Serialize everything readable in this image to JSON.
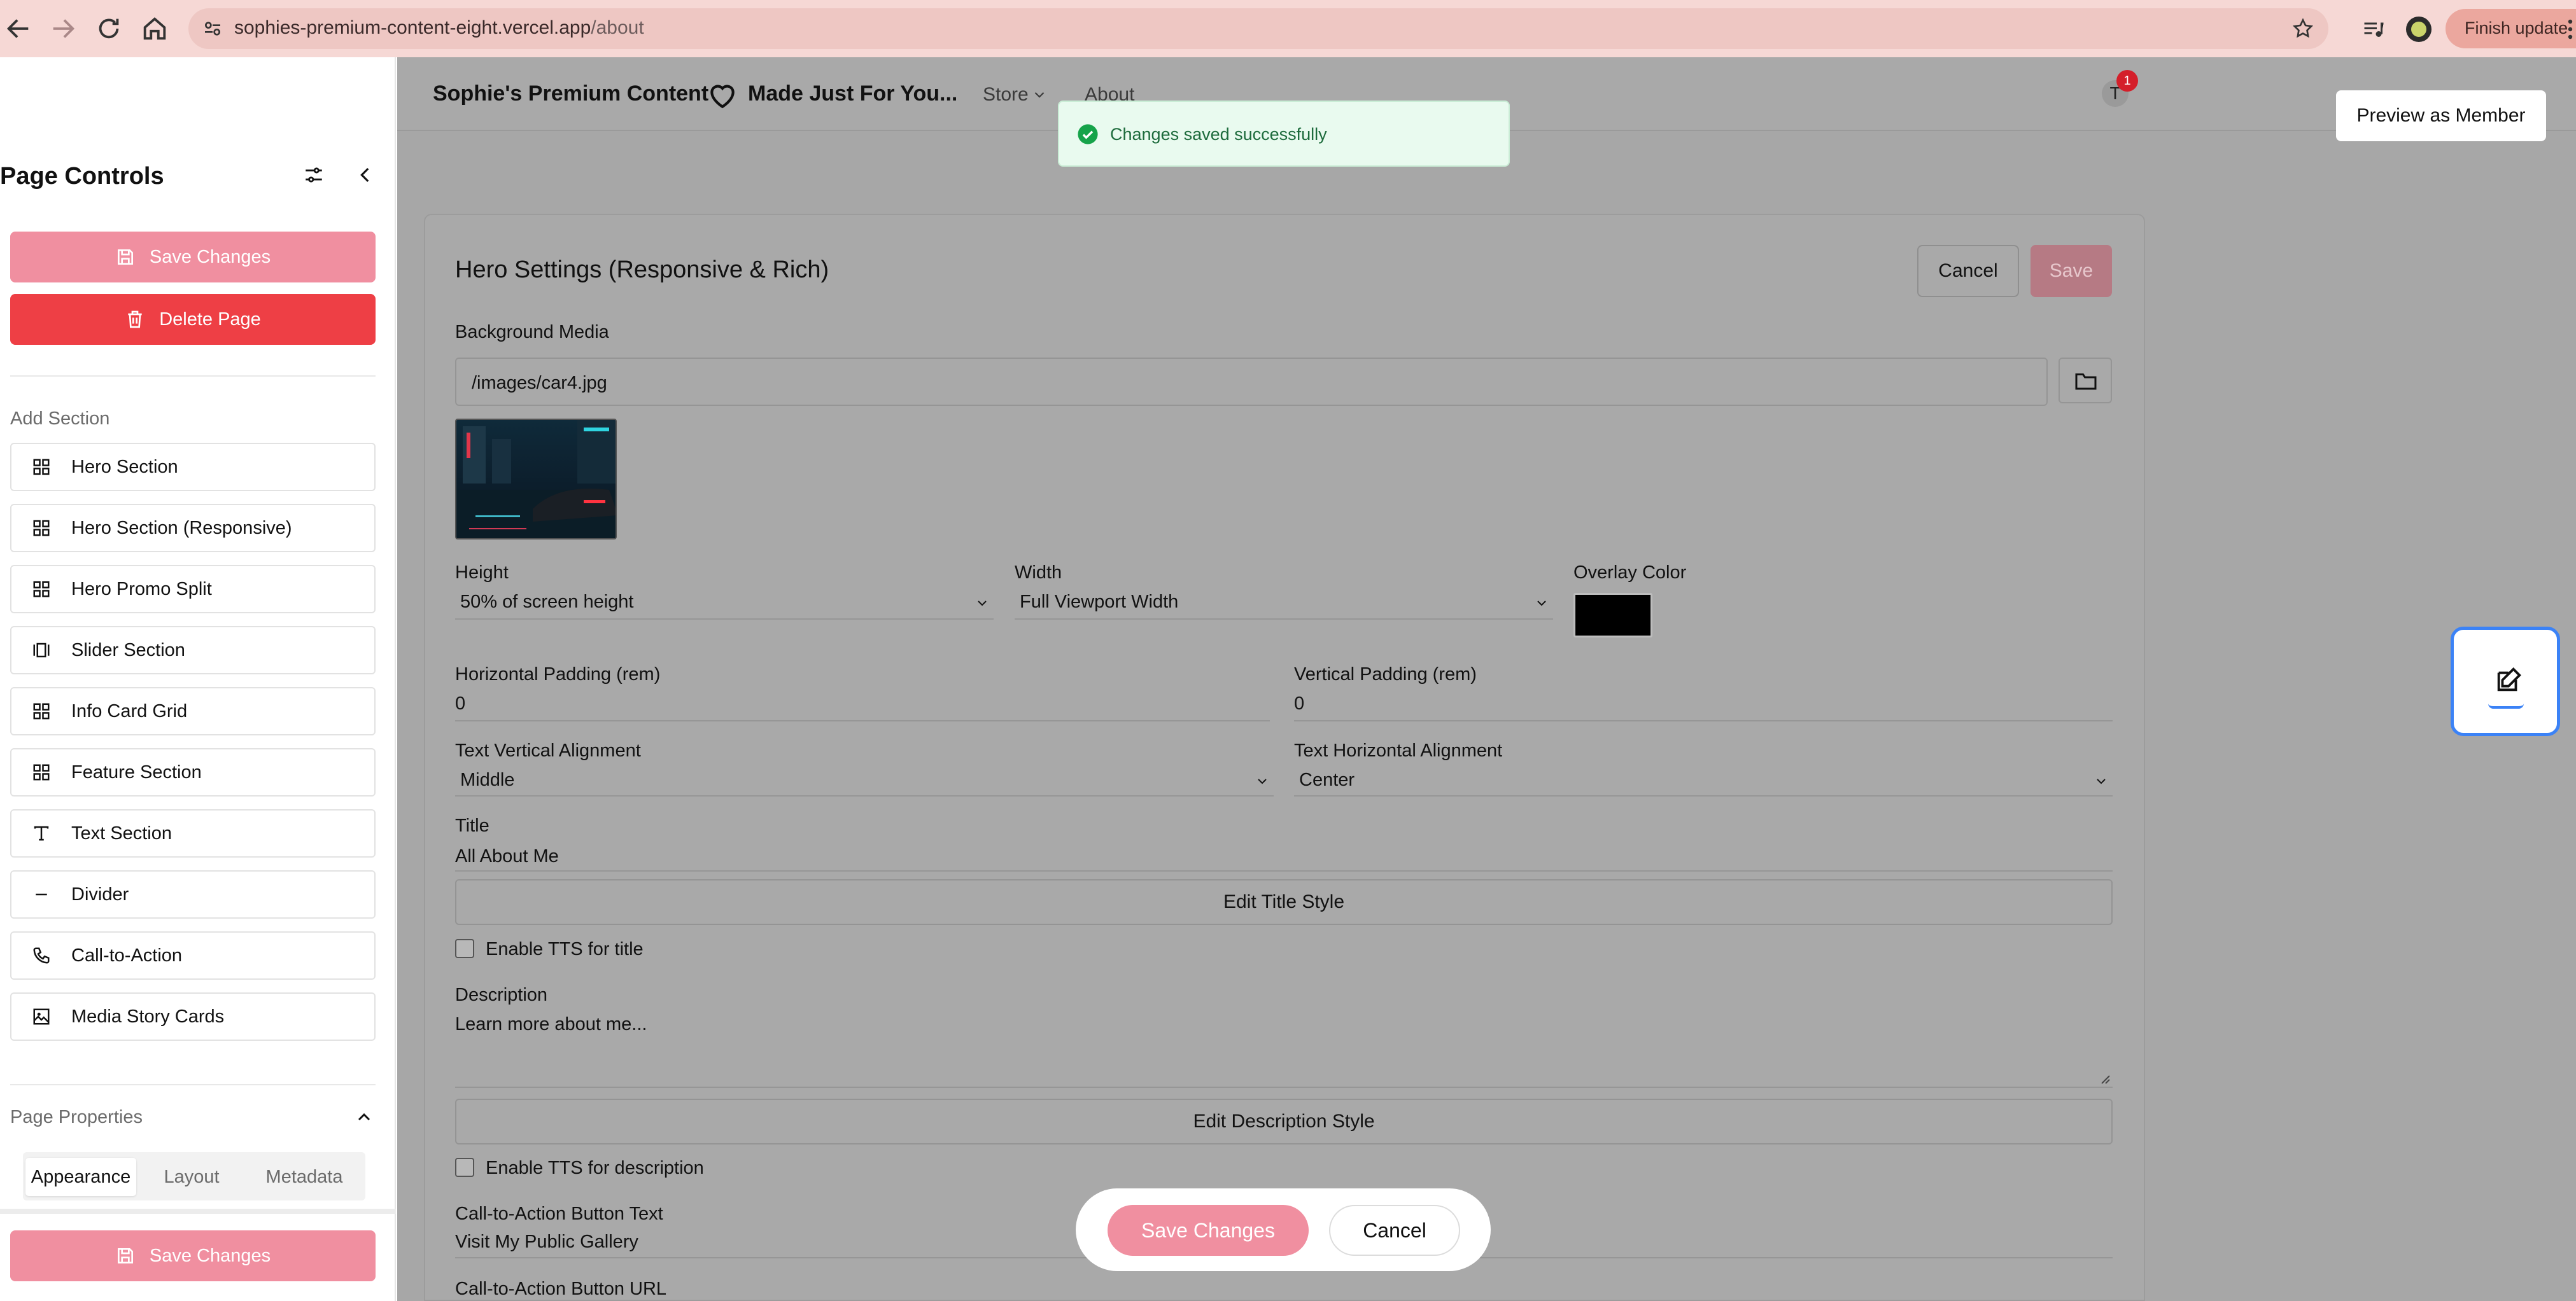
{
  "browser": {
    "url_host": "sophies-premium-content-eight.vercel.app",
    "url_path": "/about",
    "finish_update": "Finish update"
  },
  "sidebar": {
    "title": "Page Controls",
    "save_label": "Save Changes",
    "delete_label": "Delete Page",
    "add_section_label": "Add Section",
    "sections": [
      {
        "label": "Hero Section",
        "icon": "grid-icon"
      },
      {
        "label": "Hero Section (Responsive)",
        "icon": "grid-icon"
      },
      {
        "label": "Hero Promo Split",
        "icon": "grid-icon"
      },
      {
        "label": "Slider Section",
        "icon": "slider-icon"
      },
      {
        "label": "Info Card Grid",
        "icon": "grid-icon"
      },
      {
        "label": "Feature Section",
        "icon": "grid-icon"
      },
      {
        "label": "Text Section",
        "icon": "text-icon"
      },
      {
        "label": "Divider",
        "icon": "minus-icon"
      },
      {
        "label": "Call-to-Action",
        "icon": "phone-icon"
      },
      {
        "label": "Media Story Cards",
        "icon": "image-icon"
      }
    ],
    "page_properties_label": "Page Properties",
    "tabs": [
      "Appearance",
      "Layout",
      "Metadata"
    ],
    "bottom_save_label": "Save Changes"
  },
  "site": {
    "title": "Sophie's Premium Content",
    "tagline": "Made Just For You...",
    "nav": [
      "Store",
      "About"
    ],
    "avatar_letter": "T",
    "notification_count": "1",
    "preview_label": "Preview as Member"
  },
  "toast": {
    "message": "Changes saved successfully"
  },
  "editor": {
    "title": "Hero Settings (Responsive & Rich)",
    "cancel_label": "Cancel",
    "save_label": "Save",
    "background_media_label": "Background Media",
    "background_media_value": "/images/car4.jpg",
    "height_label": "Height",
    "height_value": "50% of screen height",
    "width_label": "Width",
    "width_value": "Full Viewport Width",
    "overlay_label": "Overlay Color",
    "overlay_color": "#000000",
    "hpad_label": "Horizontal Padding (rem)",
    "hpad_value": "0",
    "vpad_label": "Vertical Padding (rem)",
    "vpad_value": "0",
    "valign_label": "Text Vertical Alignment",
    "valign_value": "Middle",
    "halign_label": "Text Horizontal Alignment",
    "halign_value": "Center",
    "title_label": "Title",
    "title_value": "All About Me",
    "edit_title_style": "Edit Title Style",
    "tts_title": "Enable TTS for title",
    "description_label": "Description",
    "description_value": "Learn more about me...",
    "edit_description_style": "Edit Description Style",
    "tts_description": "Enable TTS for description",
    "cta_text_label": "Call-to-Action Button Text",
    "cta_text_value": "Visit My Public Gallery",
    "cta_url_label": "Call-to-Action Button URL"
  },
  "bottom_bar": {
    "save_label": "Save Changes",
    "cancel_label": "Cancel"
  },
  "colors": {
    "accent_pink": "#f08fa0",
    "danger_red": "#ee3f45",
    "success_green": "#1d6b3c",
    "focus_blue": "#3b82f6"
  }
}
